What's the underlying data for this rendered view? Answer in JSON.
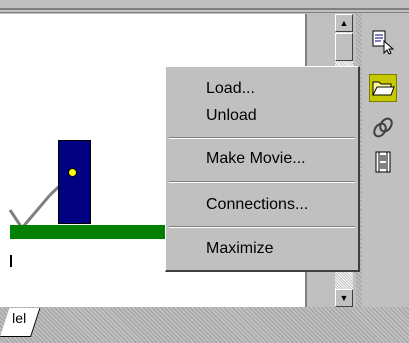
{
  "context_menu": {
    "items": [
      "Load...",
      "Unload",
      "Make Movie...",
      "Connections...",
      "Maximize"
    ]
  },
  "tabs": [
    "lel"
  ],
  "toolbar": {
    "icons": [
      "pointer-select-icon",
      "open-folder-icon",
      "link-icon",
      "film-icon"
    ],
    "active_icon": "open-folder-icon"
  },
  "scrollbar": {
    "up_arrow": "▲",
    "down_arrow": "▼"
  },
  "scene": {
    "colors": {
      "ground": "#008000",
      "door": "#000080",
      "knob": "#ffff00",
      "line": "#808080"
    }
  }
}
